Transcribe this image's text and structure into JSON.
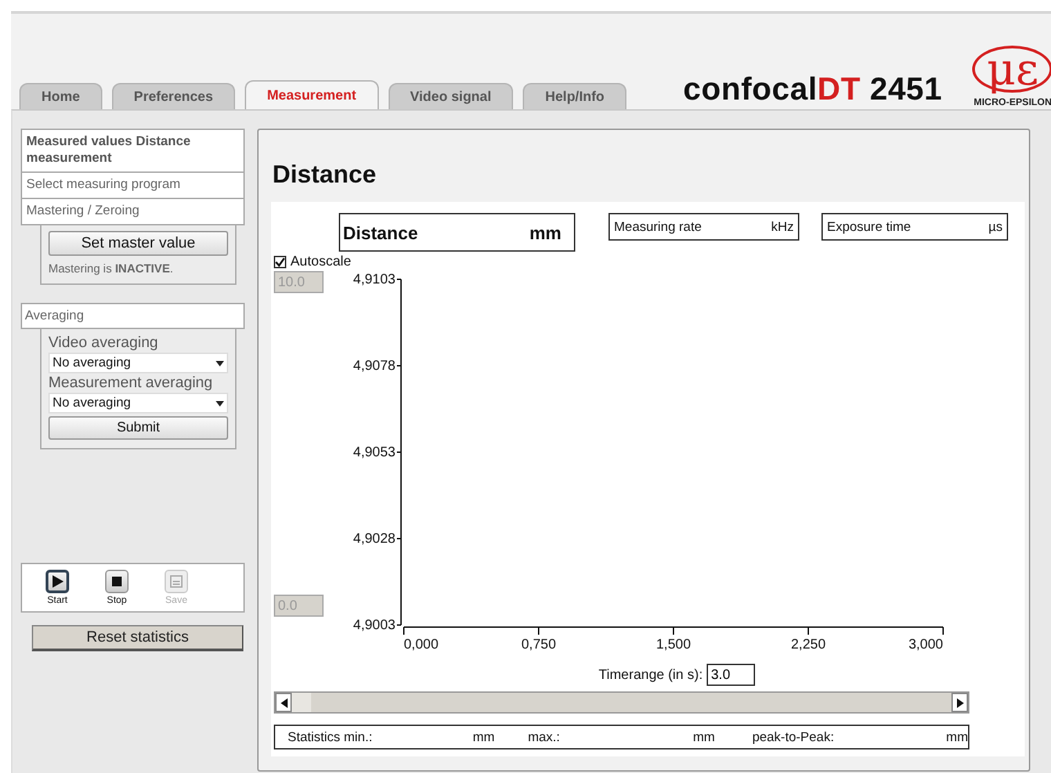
{
  "tabs": [
    {
      "label": "Home",
      "selected": false
    },
    {
      "label": "Preferences",
      "selected": false
    },
    {
      "label": "Measurement",
      "selected": true
    },
    {
      "label": "Video signal",
      "selected": false
    },
    {
      "label": "Help/Info",
      "selected": false
    }
  ],
  "product": {
    "name": "confocal",
    "highlight": "DT",
    "model": "2451"
  },
  "logo": {
    "symbol": "με",
    "company": "MICRO-EPSILON"
  },
  "sidebar": {
    "items": [
      {
        "label": "Measured values Distance measurement",
        "selected": true
      },
      {
        "label": "Select measuring program",
        "selected": false
      },
      {
        "label": "Mastering / Zeroing",
        "selected": false
      }
    ],
    "master_button": "Set master value",
    "master_status": "Mastering is **INACTIVE**.",
    "averaging": {
      "title": "Averaging",
      "video_label": "Video averaging",
      "video_value": "No averaging",
      "measurement_label": "Measurement averaging",
      "measurement_value": "No averaging",
      "submit": "Submit"
    },
    "toolbar": [
      {
        "kind": "start",
        "label": "Start",
        "disabled": false
      },
      {
        "kind": "stop",
        "label": "Stop",
        "disabled": false
      },
      {
        "kind": "save",
        "label": "Save",
        "disabled": true
      }
    ],
    "reset_button": "Reset statistics"
  },
  "main": {
    "title": "Distance",
    "readouts": [
      {
        "label": "Distance",
        "unit": "mm",
        "kind": "primary"
      },
      {
        "label": "Measuring rate",
        "unit": "kHz",
        "kind": "secondary"
      },
      {
        "label": "Exposure time",
        "unit": "µs",
        "kind": "secondary"
      }
    ],
    "autoscale": {
      "label": "Autoscale",
      "checked": true
    },
    "y_max": {
      "value": "10.0",
      "disabled": true
    },
    "y_min": {
      "value": "0.0",
      "disabled": true
    },
    "plot": {
      "x_axis_labels": [
        "0,000",
        "0,750",
        "1,500",
        "2,250",
        "3,000"
      ],
      "y_axis_labels": [
        "4,9103",
        "4,9078",
        "4,9053",
        "4,9028",
        "4,9003"
      ]
    },
    "timerange": {
      "label": "Timerange (in s):",
      "value": "3.0"
    },
    "statistics": [
      {
        "label": "Statistics min.:",
        "unit": "mm"
      },
      {
        "label": "max.:",
        "unit": "mm"
      },
      {
        "label": "peak-to-Peak:",
        "unit": "mm"
      }
    ]
  }
}
